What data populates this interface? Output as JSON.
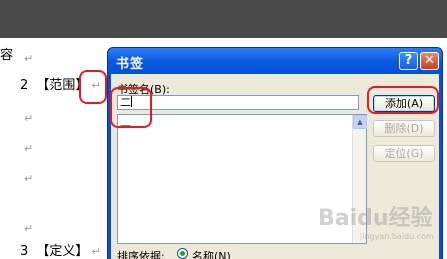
{
  "document": {
    "line_top": {
      "text": "",
      "pilcrow": "↵"
    },
    "line_range": {
      "number": "2",
      "text": "【范围】",
      "pilcrow": "↵"
    },
    "line_definition": {
      "number": "3",
      "text": "【定义】",
      "pilcrow": "↵"
    },
    "edge_char": "容",
    "pilcrow": "↵"
  },
  "dialog": {
    "title": "书签",
    "help_label": "?",
    "close_label": "✕",
    "name_label": "书签名(B):",
    "name_value": "二",
    "list_items": [
      "一"
    ],
    "buttons": {
      "add": "添加(A)",
      "delete": "删除(D)",
      "goto": "定位(G)"
    },
    "sort_label": "排序依据:",
    "sort_option": "名称(N)"
  },
  "watermark": {
    "text": "Baidu经验",
    "subtext": "jingyan.baidu.com"
  },
  "colors": {
    "highlight": "#e31b23",
    "titlebar": "#0a5ae0",
    "dialog_body": "#ece9d8"
  }
}
